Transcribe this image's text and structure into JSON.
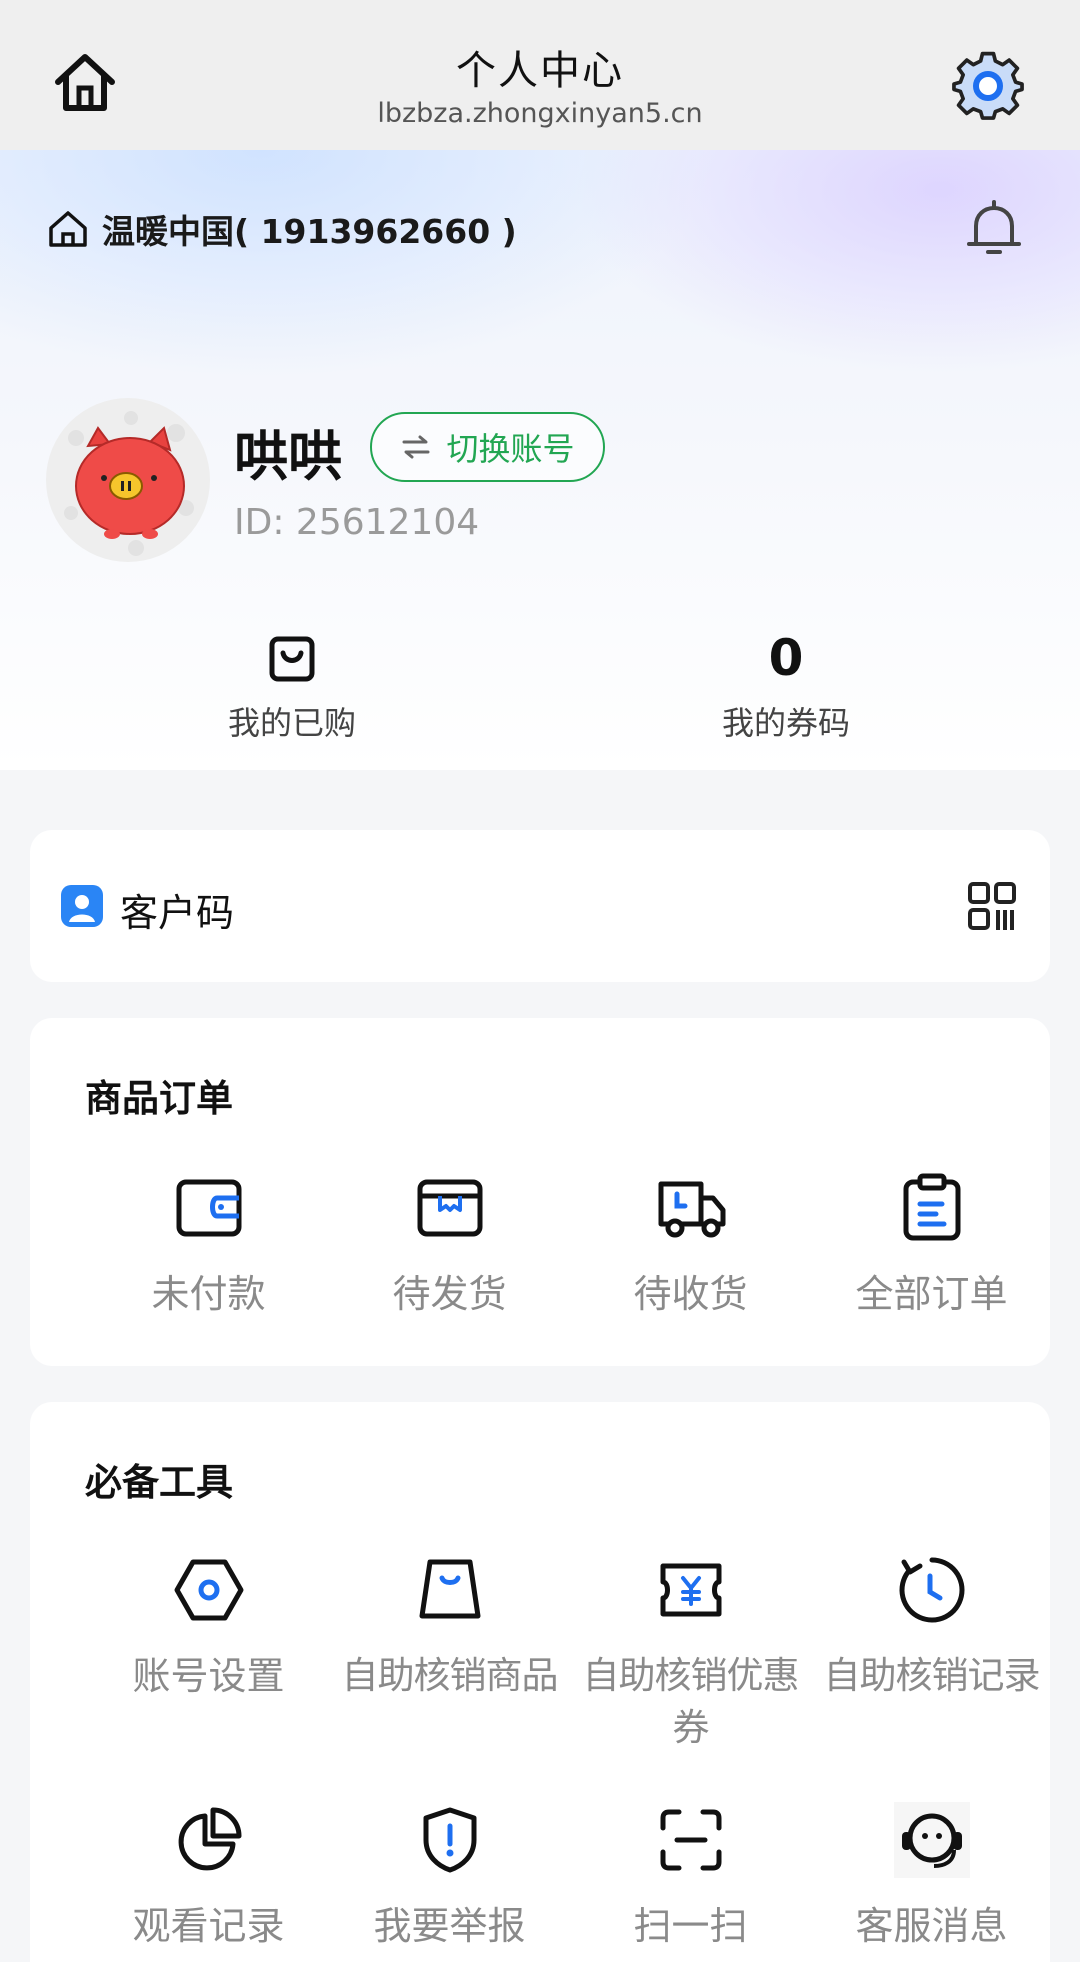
{
  "nav": {
    "title": "个人中心",
    "url": "lbzbza.zhongxinyan5.cn"
  },
  "header": {
    "shop_name": "温暖中国( 1913962660 )",
    "username": "哄哄",
    "switch_account_label": "切换账号",
    "user_id": "ID: 25612104"
  },
  "stats": {
    "purchased_label": "我的已购",
    "coupons_value": "0",
    "coupons_label": "我的券码"
  },
  "customer_code": {
    "label": "客户码"
  },
  "orders": {
    "title": "商品订单",
    "items": [
      {
        "label": "未付款",
        "icon": "wallet-icon"
      },
      {
        "label": "待发货",
        "icon": "box-icon"
      },
      {
        "label": "待收货",
        "icon": "truck-icon"
      },
      {
        "label": "全部订单",
        "icon": "clipboard-icon"
      }
    ]
  },
  "tools": {
    "title": "必备工具",
    "items": [
      {
        "label": "账号设置",
        "icon": "hexagon-settings-icon"
      },
      {
        "label": "自助核销商品",
        "icon": "bag-icon"
      },
      {
        "label": "自助核销优惠券",
        "icon": "ticket-icon"
      },
      {
        "label": "自助核销记录",
        "icon": "clock-icon"
      },
      {
        "label": "观看记录",
        "icon": "pie-chart-icon"
      },
      {
        "label": "我要举报",
        "icon": "shield-alert-icon"
      },
      {
        "label": "扫一扫",
        "icon": "scan-icon"
      },
      {
        "label": "客服消息",
        "icon": "headset-icon"
      }
    ]
  },
  "colors": {
    "accent_green": "#22a652",
    "accent_blue": "#1e6ff0",
    "nav_bg": "#efefef",
    "page_bg": "#f5f6f8"
  }
}
